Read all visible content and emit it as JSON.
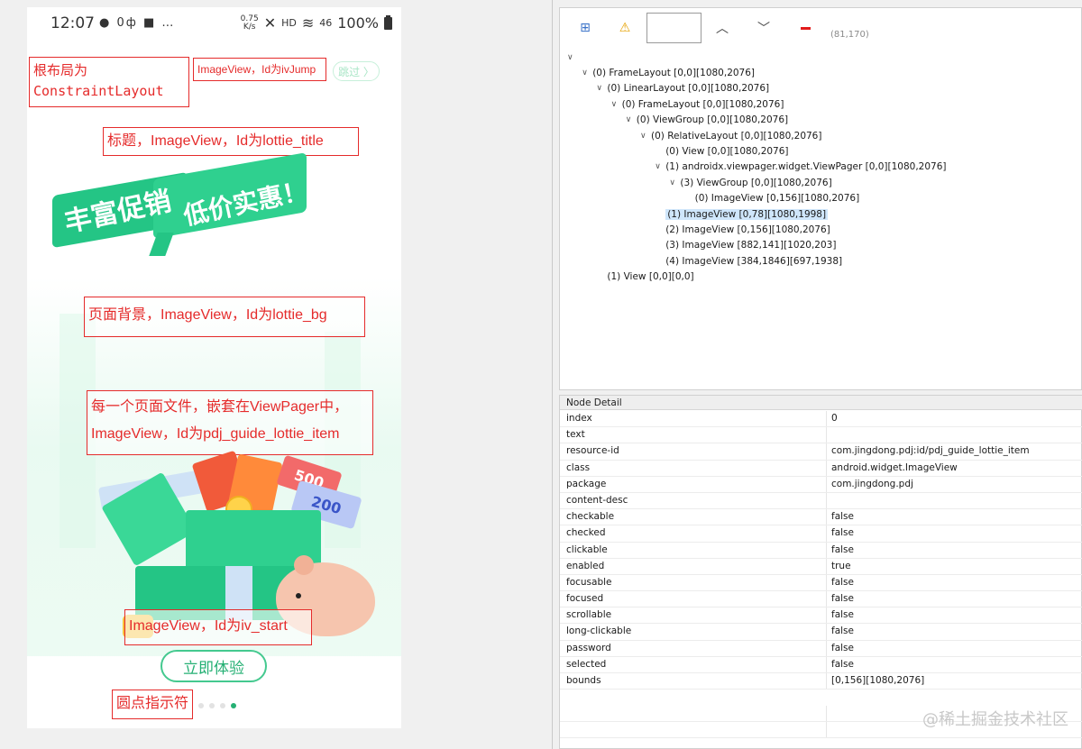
{
  "status_bar": {
    "time": "12:07",
    "left_icons": "● 0ф ■ …",
    "speed_top": "0.75",
    "speed_bottom": "K/s",
    "mini_hd": "HD",
    "signal": "46",
    "battery": "100%"
  },
  "annotations": {
    "root_line1": "根布局为",
    "root_line2": "ConstraintLayout",
    "iv_jump": "ImageView，Id为ivJump",
    "title": "标题，ImageView，Id为lottie_title",
    "bg": "页面背景，ImageView，Id为lottie_bg",
    "item_line1": "每一个页面文件，嵌套在ViewPager中，",
    "item_line2": "ImageView，Id为pdj_guide_lottie_item",
    "iv_start": "ImageView，Id为iv_start",
    "indicator": "圆点指示符"
  },
  "phone": {
    "skip_label": "跳过 〉",
    "promo_line1": "丰富促销",
    "promo_line2": "低价实惠！",
    "start_label": "立即体验",
    "coupon_a": "500",
    "coupon_b": "200",
    "dots_count": 4,
    "active_dot": 3
  },
  "toolbar": {
    "coord": "(81,170)",
    "icons": [
      "screenshot-icon",
      "warning-icon",
      "chevron-up-icon",
      "chevron-down-icon",
      "minus-icon"
    ]
  },
  "tree": [
    {
      "indent": 0,
      "expanded": true,
      "label": ""
    },
    {
      "indent": 1,
      "expanded": true,
      "label": "(0) FrameLayout [0,0][1080,2076]"
    },
    {
      "indent": 2,
      "expanded": true,
      "label": "(0) LinearLayout [0,0][1080,2076]"
    },
    {
      "indent": 3,
      "expanded": true,
      "label": "(0) FrameLayout [0,0][1080,2076]"
    },
    {
      "indent": 4,
      "expanded": true,
      "label": "(0) ViewGroup [0,0][1080,2076]"
    },
    {
      "indent": 5,
      "expanded": true,
      "label": "(0) RelativeLayout [0,0][1080,2076]"
    },
    {
      "indent": 6,
      "expanded": false,
      "label": "(0) View [0,0][1080,2076]"
    },
    {
      "indent": 6,
      "expanded": true,
      "label": "(1) androidx.viewpager.widget.ViewPager [0,0][1080,2076]"
    },
    {
      "indent": 7,
      "expanded": true,
      "label": "(3) ViewGroup [0,0][1080,2076]"
    },
    {
      "indent": 8,
      "expanded": false,
      "label": "(0) ImageView [0,156][1080,2076]"
    },
    {
      "indent": 6,
      "expanded": false,
      "label": "(1) ImageView [0,78][1080,1998]",
      "selected": true
    },
    {
      "indent": 6,
      "expanded": false,
      "label": "(2) ImageView [0,156][1080,2076]"
    },
    {
      "indent": 6,
      "expanded": false,
      "label": "(3) ImageView [882,141][1020,203]"
    },
    {
      "indent": 6,
      "expanded": false,
      "label": "(4) ImageView [384,1846][697,1938]"
    },
    {
      "indent": 2,
      "expanded": false,
      "label": "(1) View [0,0][0,0]"
    }
  ],
  "node_detail": {
    "header": "Node Detail",
    "rows": [
      {
        "key": "index",
        "value": "0"
      },
      {
        "key": "text",
        "value": ""
      },
      {
        "key": "resource-id",
        "value": "com.jingdong.pdj:id/pdj_guide_lottie_item"
      },
      {
        "key": "class",
        "value": "android.widget.ImageView"
      },
      {
        "key": "package",
        "value": "com.jingdong.pdj"
      },
      {
        "key": "content-desc",
        "value": ""
      },
      {
        "key": "checkable",
        "value": "false"
      },
      {
        "key": "checked",
        "value": "false"
      },
      {
        "key": "clickable",
        "value": "false"
      },
      {
        "key": "enabled",
        "value": "true"
      },
      {
        "key": "focusable",
        "value": "false"
      },
      {
        "key": "focused",
        "value": "false"
      },
      {
        "key": "scrollable",
        "value": "false"
      },
      {
        "key": "long-clickable",
        "value": "false"
      },
      {
        "key": "password",
        "value": "false"
      },
      {
        "key": "selected",
        "value": "false"
      },
      {
        "key": "bounds",
        "value": "[0,156][1080,2076]"
      }
    ]
  },
  "watermark": "@稀土掘金技术社区",
  "colors": {
    "brand_green": "#25b074",
    "annotation_red": "#e52b2b",
    "selection_blue": "#cfe6fb"
  }
}
